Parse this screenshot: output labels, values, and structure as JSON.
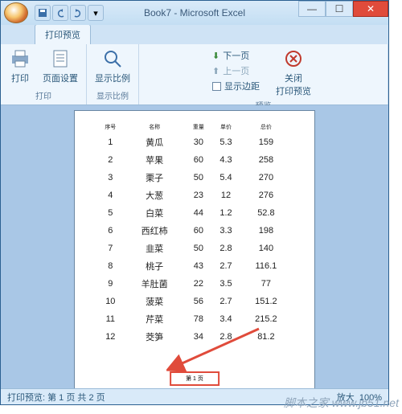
{
  "title": "Book7 - Microsoft Excel",
  "tab": "打印预览",
  "ribbon": {
    "print": "打印",
    "page_setup": "页面设置",
    "zoom": "显示比例",
    "next_page": "下一页",
    "prev_page": "上一页",
    "show_margins": "显示边距",
    "close_preview": "关闭\n打印预览",
    "group_print": "打印",
    "group_zoom": "显示比例",
    "group_preview": "预览"
  },
  "table": {
    "headers": [
      "序号",
      "名称",
      "重量",
      "单价",
      "总价"
    ],
    "rows": [
      [
        "1",
        "黄瓜",
        "30",
        "5.3",
        "159"
      ],
      [
        "2",
        "苹果",
        "60",
        "4.3",
        "258"
      ],
      [
        "3",
        "栗子",
        "50",
        "5.4",
        "270"
      ],
      [
        "4",
        "大葱",
        "23",
        "12",
        "276"
      ],
      [
        "5",
        "白菜",
        "44",
        "1.2",
        "52.8"
      ],
      [
        "6",
        "西红柿",
        "60",
        "3.3",
        "198"
      ],
      [
        "7",
        "韭菜",
        "50",
        "2.8",
        "140"
      ],
      [
        "8",
        "桃子",
        "43",
        "2.7",
        "116.1"
      ],
      [
        "9",
        "羊肚菌",
        "22",
        "3.5",
        "77"
      ],
      [
        "10",
        "菠菜",
        "56",
        "2.7",
        "151.2"
      ],
      [
        "11",
        "芹菜",
        "78",
        "3.4",
        "215.2"
      ],
      [
        "12",
        "茭笋",
        "34",
        "2.8",
        "81.2"
      ]
    ]
  },
  "page_footer": "第 1 页",
  "status_left": "打印预览: 第 1 页  共 2 页",
  "status_zoom": "放大",
  "status_pct": "100%",
  "watermark": "脚本之家  www.jb51.net"
}
